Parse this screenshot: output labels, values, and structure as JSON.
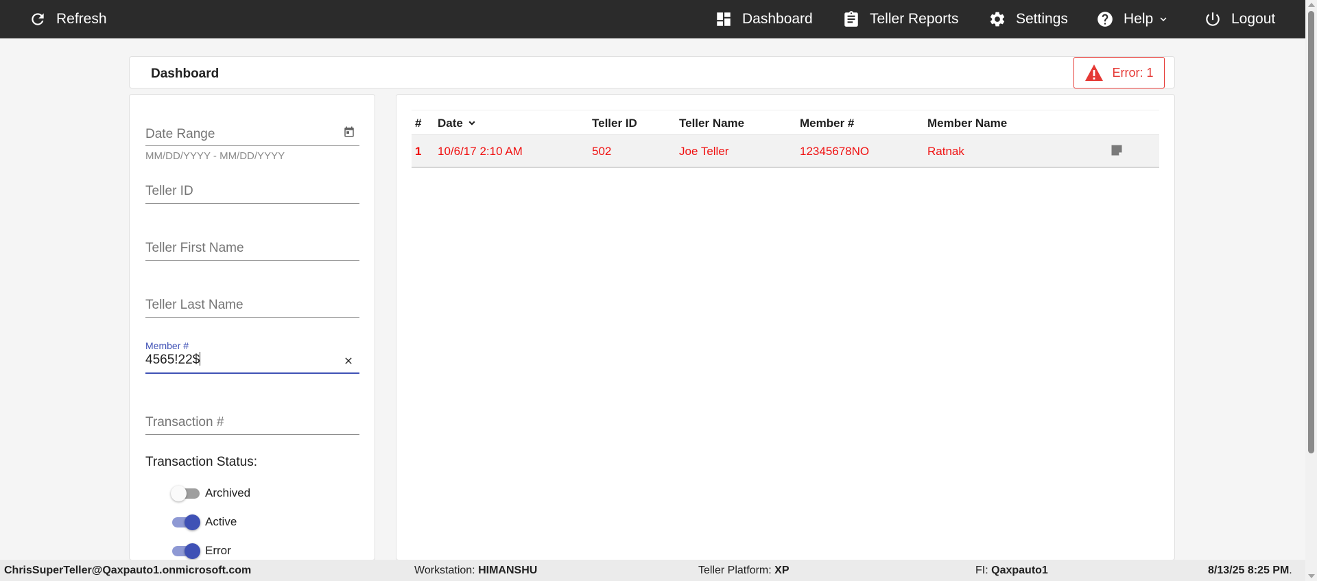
{
  "nav": {
    "refresh": "Refresh",
    "dashboard": "Dashboard",
    "teller_reports": "Teller Reports",
    "settings": "Settings",
    "help": "Help",
    "logout": "Logout"
  },
  "header": {
    "title": "Dashboard",
    "error_badge": "Error: 1"
  },
  "filters": {
    "date_range_placeholder": "Date Range",
    "date_range_hint": "MM/DD/YYYY - MM/DD/YYYY",
    "teller_id_placeholder": "Teller ID",
    "teller_first_name_placeholder": "Teller First Name",
    "teller_last_name_placeholder": "Teller Last Name",
    "member_label": "Member #",
    "member_value": "4565!22$",
    "transaction_placeholder": "Transaction #",
    "status_label": "Transaction Status:",
    "statuses": [
      {
        "label": "Archived",
        "on": false
      },
      {
        "label": "Active",
        "on": true
      },
      {
        "label": "Error",
        "on": true
      }
    ]
  },
  "table": {
    "headers": {
      "num": "#",
      "date": "Date",
      "teller_id": "Teller ID",
      "teller_name": "Teller Name",
      "member_num": "Member #",
      "member_name": "Member Name"
    },
    "rows": [
      {
        "num": "1",
        "date": "10/6/17 2:10 AM",
        "teller_id": "502",
        "teller_name": "Joe Teller",
        "member_num": "12345678NO",
        "member_name": "Ratnak"
      }
    ]
  },
  "footer": {
    "user": "ChrisSuperTeller@Qaxpauto1.onmicrosoft.com",
    "workstation_label": "Workstation:",
    "workstation": "HIMANSHU",
    "platform_label": "Teller Platform:",
    "platform": "XP",
    "fi_label": "FI:",
    "fi": "Qaxpauto1",
    "datetime": "8/13/25 8:25 PM",
    "datetime_suffix": "."
  },
  "colors": {
    "nav_bg": "#2b2b2b",
    "error": "#e53935",
    "row_text": "#f01010",
    "accent": "#3f51b5"
  },
  "icons": {
    "refresh": "refresh-icon",
    "dashboard": "dashboard-icon",
    "reports": "clipboard-icon",
    "settings": "gear-icon",
    "help": "help-circle-icon",
    "logout": "power-icon",
    "error": "warning-triangle-icon",
    "calendar": "calendar-icon",
    "clear": "close-icon",
    "note": "note-icon"
  }
}
